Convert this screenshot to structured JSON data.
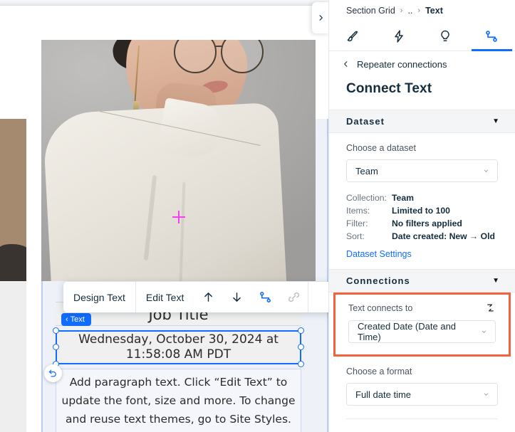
{
  "panel": {
    "breadcrumb": {
      "root": "Section Grid",
      "middle": "..",
      "current": "Text",
      "separator": "›"
    },
    "tabs": [
      {
        "name": "design",
        "icon": "paintbrush-icon",
        "active": false
      },
      {
        "name": "animations",
        "icon": "lightning-bolt-icon",
        "active": false
      },
      {
        "name": "ideas",
        "icon": "lightbulb-icon",
        "active": false
      },
      {
        "name": "connect",
        "icon": "connection-icon",
        "active": true
      }
    ],
    "back_link": "Repeater connections",
    "title": "Connect Text",
    "dataset_section": {
      "header": "Dataset",
      "caret": "▼",
      "choose_label": "Choose a dataset",
      "selected_dataset": "Team",
      "details": [
        {
          "key": "Collection:",
          "value": "Team"
        },
        {
          "key": "Items:",
          "value": "Limited to 100"
        },
        {
          "key": "Filter:",
          "value": "No filters applied"
        },
        {
          "key": "Sort:",
          "value": "Date created: New → Old"
        }
      ],
      "settings_link": "Dataset Settings"
    },
    "connections_section": {
      "header": "Connections",
      "caret": "▼",
      "connects_label": "Text connects to",
      "connects_value": "Created Date (Date and Time)",
      "swap_icon": "connection-swap-icon",
      "highlight_color": "#f4613f"
    },
    "format_section": {
      "label": "Choose a format",
      "value": "Full date time"
    }
  },
  "canvas": {
    "toolbar": {
      "design_text": "Design Text",
      "edit_text": "Edit Text",
      "move_up_icon": "arrow-up-icon",
      "move_down_icon": "arrow-down-icon",
      "connect_icon": "connection-icon",
      "link_icon": "link-icon"
    },
    "element_badge": "Text",
    "badge_chevron": "‹",
    "job_title": "Job Title",
    "selected_text": "Wednesday, October 30, 2024 at 11:58:08 AM PDT",
    "paragraph_text": "Add paragraph text. Click “Edit Text” to update the font, size and more. To change and reuse text themes, go to Site Styles.",
    "undo_icon": "undo-icon",
    "collapse_icon": "chevron-right-icon",
    "crosshair": "crosshair-marker"
  },
  "colors": {
    "accent_blue": "#116dff",
    "highlight_orange": "#f4613f",
    "crosshair_magenta": "#f13ff1",
    "text_dark": "#162d3d"
  }
}
